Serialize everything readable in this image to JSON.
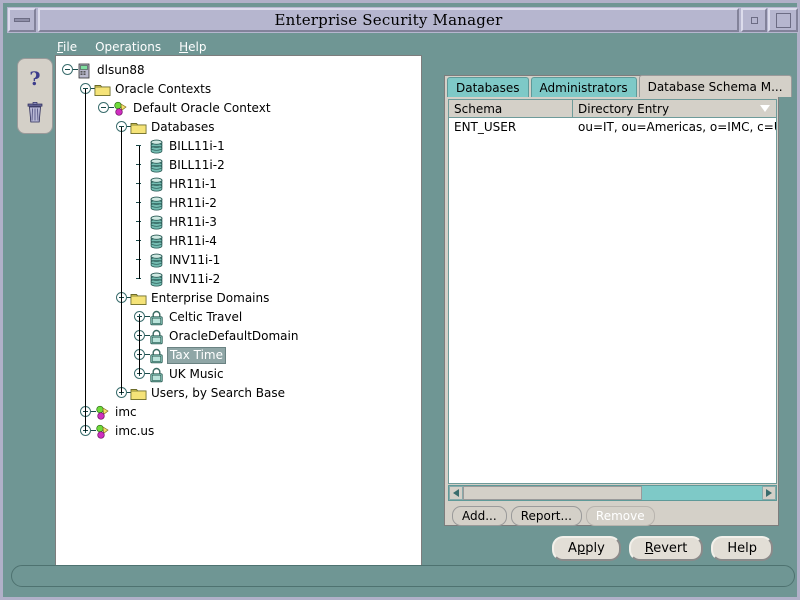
{
  "window": {
    "title": "Enterprise Security Manager",
    "menu_button": "window-menu",
    "minimize": "minimize",
    "maximize": "maximize"
  },
  "menubar": {
    "items": [
      {
        "label": "File",
        "mnemonic": "F"
      },
      {
        "label": "Operations",
        "mnemonic": "O"
      },
      {
        "label": "Help",
        "mnemonic": "H"
      }
    ]
  },
  "toolbar": {
    "items": [
      {
        "name": "help-question-icon",
        "glyph": "?"
      },
      {
        "name": "trash-icon",
        "glyph": "trash"
      }
    ]
  },
  "tree": {
    "nodes": [
      {
        "label": "dlsun88",
        "depth": 0,
        "icon": "server-icon",
        "state": "expanded",
        "selected": false
      },
      {
        "label": "Oracle Contexts",
        "depth": 1,
        "icon": "folder-icon",
        "state": "expanded",
        "selected": false
      },
      {
        "label": "Default Oracle Context",
        "depth": 2,
        "icon": "context-icon",
        "state": "expanded",
        "selected": false
      },
      {
        "label": "Databases",
        "depth": 3,
        "icon": "folder-icon",
        "state": "expanded",
        "selected": false
      },
      {
        "label": "BILL11i-1",
        "depth": 4,
        "icon": "database-icon",
        "state": "leaf",
        "selected": false
      },
      {
        "label": "BILL11i-2",
        "depth": 4,
        "icon": "database-icon",
        "state": "leaf",
        "selected": false
      },
      {
        "label": "HR11i-1",
        "depth": 4,
        "icon": "database-icon",
        "state": "leaf",
        "selected": false
      },
      {
        "label": "HR11i-2",
        "depth": 4,
        "icon": "database-icon",
        "state": "leaf",
        "selected": false
      },
      {
        "label": "HR11i-3",
        "depth": 4,
        "icon": "database-icon",
        "state": "leaf",
        "selected": false
      },
      {
        "label": "HR11i-4",
        "depth": 4,
        "icon": "database-icon",
        "state": "leaf",
        "selected": false
      },
      {
        "label": "INV11i-1",
        "depth": 4,
        "icon": "database-icon",
        "state": "leaf",
        "selected": false
      },
      {
        "label": "INV11i-2",
        "depth": 4,
        "icon": "database-icon",
        "state": "leaf",
        "selected": false
      },
      {
        "label": "Enterprise Domains",
        "depth": 3,
        "icon": "folder-icon",
        "state": "expanded",
        "selected": false
      },
      {
        "label": "Celtic Travel",
        "depth": 4,
        "icon": "domain-icon",
        "state": "collapsed",
        "selected": false
      },
      {
        "label": "OracleDefaultDomain",
        "depth": 4,
        "icon": "domain-icon",
        "state": "collapsed",
        "selected": false
      },
      {
        "label": "Tax Time",
        "depth": 4,
        "icon": "domain-icon",
        "state": "collapsed",
        "selected": true
      },
      {
        "label": "UK Music",
        "depth": 4,
        "icon": "domain-icon",
        "state": "collapsed",
        "selected": false
      },
      {
        "label": "Users, by Search Base",
        "depth": 3,
        "icon": "folder-icon",
        "state": "collapsed",
        "selected": false
      },
      {
        "label": "imc",
        "depth": 1,
        "icon": "context-icon",
        "state": "collapsed",
        "selected": false
      },
      {
        "label": "imc.us",
        "depth": 1,
        "icon": "context-icon",
        "state": "collapsed",
        "selected": false
      }
    ]
  },
  "right_panel": {
    "tabs": [
      {
        "label": "Databases",
        "active": false
      },
      {
        "label": "Administrators",
        "active": false
      },
      {
        "label": "Database Schema M...",
        "active": true
      }
    ],
    "table": {
      "columns": [
        "Schema",
        "Directory Entry"
      ],
      "sorted_column": "Directory Entry",
      "rows": [
        [
          "ENT_USER",
          "ou=IT, ou=Americas, o=IMC, c=US"
        ]
      ]
    },
    "scrollbar": {
      "left_arrow": "scroll-left",
      "right_arrow": "scroll-right",
      "thumb_fraction": 60
    },
    "actions": [
      {
        "label": "Add...",
        "enabled": true
      },
      {
        "label": "Report...",
        "enabled": true
      },
      {
        "label": "Remove",
        "enabled": false
      }
    ]
  },
  "bottom_buttons": [
    {
      "label": "Apply",
      "mnemonic": "p"
    },
    {
      "label": "Revert",
      "mnemonic": "R"
    },
    {
      "label": "Help",
      "mnemonic": ""
    }
  ],
  "statusbar": {
    "text": ""
  },
  "colors": {
    "desktop_teal": "#6f9694",
    "titlebar": "#b6b6cf",
    "panel_gray": "#d4d0c8",
    "tab_inactive": "#7ec9c7",
    "selection": "#8fa6a6",
    "folder_yellow": "#f2dc5a"
  }
}
